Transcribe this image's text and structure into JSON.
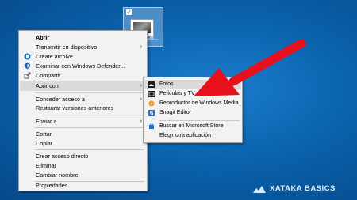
{
  "desktop": {
    "file_label": "F73608...",
    "checkbox_mark": "✓"
  },
  "context_menu": {
    "items": [
      {
        "label": "Abrir",
        "bold": true
      },
      {
        "label": "Transmitir en dispositivo",
        "submenu": true
      },
      {
        "label": "Create archive",
        "icon": "archive-icon"
      },
      {
        "label": "Examinar con Windows Defender...",
        "icon": "windows-defender-icon"
      },
      {
        "label": "Compartir",
        "icon": "share-icon"
      },
      {
        "label": "Abrir con",
        "submenu": true,
        "highlighted": true
      },
      {
        "label": "Conceder acceso a",
        "submenu": true
      },
      {
        "label": "Restaurar versiones anteriores"
      },
      {
        "label": "Enviar a",
        "submenu": true
      },
      {
        "label": "Cortar"
      },
      {
        "label": "Copiar"
      },
      {
        "label": "Crear acceso directo"
      },
      {
        "label": "Eliminar"
      },
      {
        "label": "Cambiar nombre"
      },
      {
        "label": "Propiedades"
      }
    ],
    "arrow_glyph": "›"
  },
  "open_with_submenu": {
    "items": [
      {
        "label": "Fotos",
        "icon": "photos-app-icon",
        "highlighted": true
      },
      {
        "label": "Películas y TV",
        "icon": "movies-tv-icon"
      },
      {
        "label": "Reproductor de Windows Media",
        "icon": "windows-media-player-icon"
      },
      {
        "label": "Snagit Editor",
        "icon": "snagit-icon"
      },
      {
        "label": "Buscar en Microsoft Store",
        "icon": "microsoft-store-icon"
      },
      {
        "label": "Elegir otra aplicación"
      }
    ]
  },
  "watermark": {
    "text": "XATAKA BASICS"
  },
  "colors": {
    "desktop": "#075ea8",
    "menu_bg": "#f2f2f2",
    "highlight": "#dadada",
    "annotation_arrow": "#e8101c"
  }
}
